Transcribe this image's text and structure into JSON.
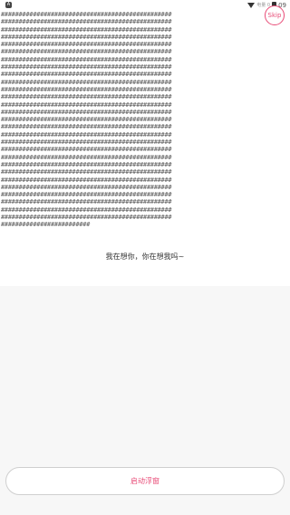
{
  "status_bar": {
    "notification_icon": "A",
    "sim_text": "电量 0",
    "time": "09"
  },
  "skip": {
    "label": "Skip"
  },
  "hash_art": {
    "lines": [
      "################################################",
      "################################################",
      "################################################",
      "################################################",
      "################################################",
      "################################################",
      "################################################",
      "################################################",
      "################################################",
      "################################################",
      "################################################",
      "################################################",
      "################################################",
      "################################################",
      "################################################",
      "################################################",
      "################################################",
      "################################################",
      "################################################",
      "################################################",
      "################################################",
      "################################################",
      "################################################",
      "################################################",
      "################################################",
      "################################################",
      "################################################",
      "################################################",
      "#########################"
    ]
  },
  "message": {
    "text": "我在想你，你在想我吗~"
  },
  "bottom_button": {
    "label": "启动浮窗"
  },
  "colors": {
    "accent": "#e84a76",
    "text": "#333333",
    "hash": "#595959",
    "background": "#f7f7f7"
  }
}
